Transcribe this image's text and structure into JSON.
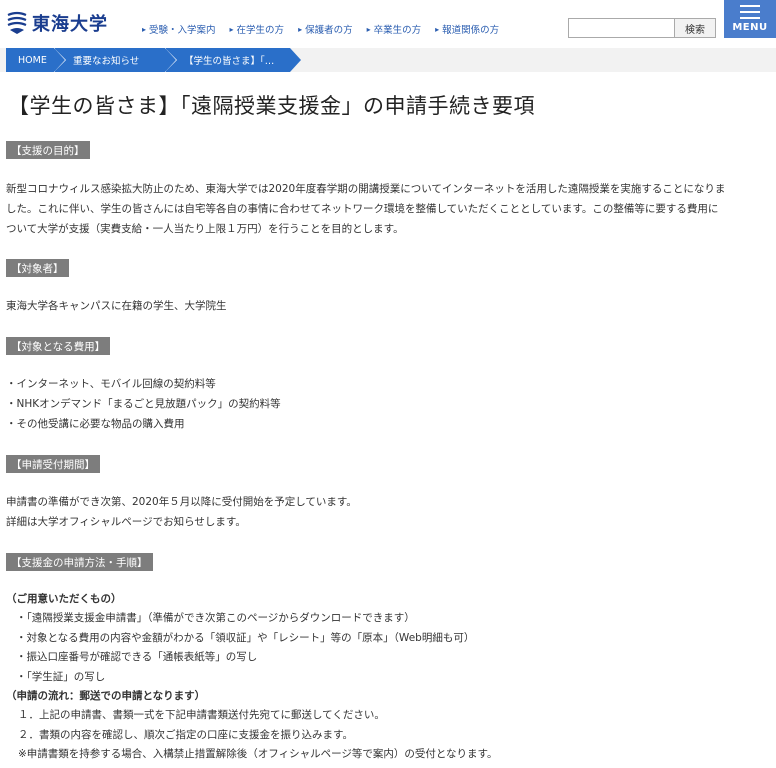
{
  "header": {
    "logo_text": "東海大学",
    "nav": [
      "受験・入学案内",
      "在学生の方",
      "保護者の方",
      "卒業生の方",
      "報道関係の方"
    ],
    "search_placeholder": "",
    "search_button": "検索",
    "menu_label": "MENU"
  },
  "breadcrumb": [
    "HOME",
    "重要なお知らせ",
    "【学生の皆さま】「…"
  ],
  "title": "【学生の皆さま】「遠隔授業支援金」の申請手続き要項",
  "sections": {
    "purpose": {
      "label": "【支援の目的】",
      "lines": [
        "新型コロナウィルス感染拡大防止のため、東海大学では2020年度春学期の開講授業についてインターネットを活用した遠隔授業を実施することになりま",
        "した。これに伴い、学生の皆さんには自宅等各自の事情に合わせてネットワーク環境を整備していただくこととしています。この整備等に要する費用に",
        "ついて大学が支援（実費支給・一人当たり上限１万円）を行うことを目的とします。"
      ]
    },
    "target": {
      "label": "【対象者】",
      "lines": [
        "東海大学各キャンパスに在籍の学生、大学院生"
      ]
    },
    "costs": {
      "label": "【対象となる費用】",
      "lines": [
        "・インターネット、モバイル回線の契約料等",
        "・NHKオンデマンド「まるごと見放題パック」の契約料等",
        "・その他受講に必要な物品の購入費用"
      ]
    },
    "period": {
      "label": "【申請受付期間】",
      "lines": [
        "申請書の準備ができ次第、2020年５月以降に受付開始を予定しています。",
        "詳細は大学オフィシャルページでお知らせします。"
      ]
    },
    "method": {
      "label": "【支援金の申請方法・手順】",
      "prep_heading": "（ご用意いただくもの）",
      "prep_items": [
        "・「遠隔授業支援金申請書」（準備ができ次第このページからダウンロードできます）",
        "・対象となる費用の内容や金額がわかる「領収証」や「レシート」等の「原本」（Web明細も可）",
        "・振込口座番号が確認できる「通帳表紙等」の写し",
        "・「学生証」の写し"
      ],
      "flow_heading": "（申請の流れ：郵送での申請となります）",
      "flow_items": [
        "１．上記の申請書、書類一式を下記申請書類送付先宛てに郵送してください。",
        "２．書類の内容を確認し、順次ご指定の口座に支援金を振り込みます。",
        "※申請書類を持参する場合、入構禁止措置解除後（オフィシャルページ等で案内）の受付となります。"
      ]
    }
  },
  "colors": {
    "brand": "#1a3d8f",
    "accent": "#2a6fc9",
    "menu": "#4a7dcc",
    "section_label": "#7d7d7d"
  }
}
